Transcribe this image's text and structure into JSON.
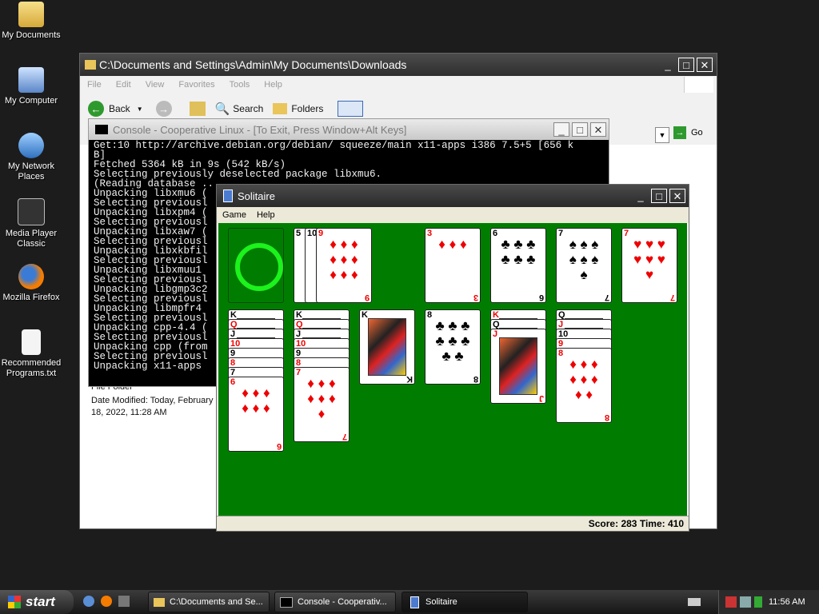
{
  "desktop": {
    "icons": [
      {
        "label": "My Documents"
      },
      {
        "label": "My Computer"
      },
      {
        "label": "My Network Places"
      },
      {
        "label": "Media Player Classic"
      },
      {
        "label": "Mozilla Firefox"
      },
      {
        "label": "Recommended Programs.txt"
      }
    ]
  },
  "explorer": {
    "title": "C:\\Documents and Settings\\Admin\\My Documents\\Downloads",
    "menu": [
      "File",
      "Edit",
      "View",
      "Favorites",
      "Tools",
      "Help"
    ],
    "toolbar": {
      "back": "Back",
      "search": "Search",
      "folders": "Folders"
    },
    "go": "Go",
    "details": {
      "type": "File Folder",
      "modified": "Date Modified: Today, February 18, 2022, 11:28 AM"
    }
  },
  "console": {
    "title": "Console - Cooperative Linux - [To Exit, Press Window+Alt Keys]",
    "lines": [
      "Get:10 http://archive.debian.org/debian/ squeeze/main x11-apps i386 7.5+5 [656 k",
      "B]",
      "Fetched 5364 kB in 9s (542 kB/s)",
      "Selecting previously deselected package libxmu6.",
      "(Reading database ...",
      "Unpacking libxmu6 (",
      "Selecting previousl",
      "Unpacking libxpm4 (",
      "Selecting previousl",
      "Unpacking libxaw7 (",
      "Selecting previousl",
      "Unpacking libxkbfil",
      "Selecting previousl",
      "Unpacking libxmuu1",
      "Selecting previousl",
      "Unpacking libgmp3c2",
      "Selecting previousl",
      "Unpacking libmpfr4",
      "Selecting previousl",
      "Unpacking cpp-4.4 (",
      "Selecting previousl",
      "Unpacking cpp (from",
      "Selecting previousl",
      "Unpacking x11-apps"
    ]
  },
  "solitaire": {
    "title": "Solitaire",
    "menu": [
      "Game",
      "Help"
    ],
    "score_label": "Score:",
    "score": "283",
    "time_label": "Time:",
    "time": "410",
    "foundations": [
      {
        "rank": "3",
        "suit": "♦",
        "color": "red"
      },
      {
        "rank": "6",
        "suit": "♣",
        "color": "black"
      },
      {
        "rank": "7",
        "suit": "♠",
        "color": "black"
      },
      {
        "rank": "7",
        "suit": "♥",
        "color": "red"
      }
    ],
    "waste": [
      {
        "rank": "5",
        "suit": "♠",
        "color": "black"
      },
      {
        "rank": "10",
        "suit": "♠",
        "color": "black"
      },
      {
        "rank": "9",
        "suit": "♦",
        "color": "red"
      }
    ],
    "tableau": [
      {
        "cards": [
          "K",
          "Q",
          "J",
          "10",
          "9",
          "8",
          "7",
          "6"
        ],
        "top": {
          "rank": "6",
          "suit": "♦",
          "color": "red"
        }
      },
      {
        "cards": [
          "K",
          "Q",
          "J",
          "10",
          "9",
          "8",
          "7"
        ],
        "top": {
          "rank": "7",
          "suit": "♦",
          "color": "red"
        }
      },
      {
        "cards": [
          "K"
        ],
        "top": {
          "rank": "K",
          "suit": "♠",
          "color": "black"
        }
      },
      {
        "cards": [
          "8"
        ],
        "top": {
          "rank": "8",
          "suit": "♣",
          "color": "black"
        }
      },
      {
        "cards": [
          "K",
          "Q",
          "J"
        ],
        "top": {
          "rank": "J",
          "suit": "♦",
          "color": "red"
        }
      },
      {
        "cards": [
          "Q",
          "J",
          "10",
          "9",
          "8"
        ],
        "top": {
          "rank": "8",
          "suit": "♦",
          "color": "red"
        }
      }
    ]
  },
  "taskbar": {
    "start": "start",
    "tasks": [
      {
        "label": "C:\\Documents and Se..."
      },
      {
        "label": "Console - Cooperativ..."
      },
      {
        "label": "Solitaire"
      }
    ],
    "clock": "11:56 AM"
  }
}
